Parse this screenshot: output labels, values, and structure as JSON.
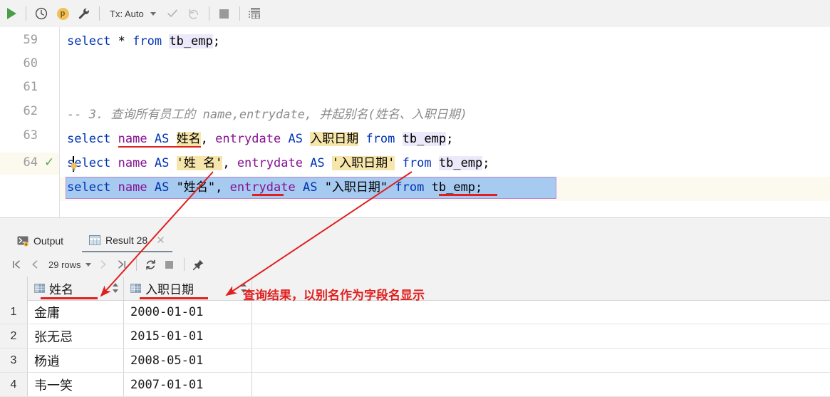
{
  "toolbar": {
    "run_icon": "run-triangle-icon",
    "history_icon": "clock-history-icon",
    "profile_icon": "profile-p-icon",
    "profile_letter": "p",
    "settings_icon": "wrench-icon",
    "tx_label": "Tx: Auto",
    "tx_chevron_icon": "chevron-down-icon",
    "commit_icon": "commit-check-icon",
    "rollback_icon": "rollback-icon",
    "stop_icon": "stop-square-icon",
    "data_editor_icon": "table-grid-icon"
  },
  "editor": {
    "lines": [
      {
        "num": "59",
        "marker": ""
      },
      {
        "num": "60",
        "marker": ""
      },
      {
        "num": "61",
        "marker": ""
      },
      {
        "num": "62",
        "marker": ""
      },
      {
        "num": "63",
        "marker": ""
      },
      {
        "num": "64",
        "marker": "check-icon"
      }
    ],
    "line59": {
      "kw1": "select",
      "star": " * ",
      "kw2": "from",
      "space": " ",
      "table": "tb_emp",
      "semi": ";"
    },
    "line61_comment": "-- 3. 查询所有员工的 name,entrydate, 并起别名(姓名、入职日期)",
    "line62": {
      "kw_select": "select",
      "col1": "name",
      "kw_as1": "AS",
      "alias1": "姓名",
      "comma": ", ",
      "col2": "entrydate",
      "kw_as2": "AS",
      "alias2": "入职日期",
      "kw_from": "from",
      "table": "tb_emp",
      "semi": ";"
    },
    "line63": {
      "kw_select": "select",
      "col1": "name",
      "kw_as1": "AS",
      "alias1": "'姓 名'",
      "comma": ", ",
      "col2": "entrydate",
      "kw_as2": "AS",
      "alias2": "'入职日期'",
      "kw_from": "from",
      "table": "tb_emp",
      "semi": ";"
    },
    "line64": {
      "kw_select": "select",
      "col1": "name",
      "kw_as1": "AS",
      "alias1": "\"姓名\"",
      "comma": ", ",
      "col2": "entrydate",
      "kw_as2": "AS",
      "alias2": "\"入职日期\"",
      "kw_from": "from",
      "table": "tb_emp",
      "semi": ";"
    }
  },
  "panel": {
    "tabs": [
      {
        "label": "Output",
        "icon": "console-output-icon",
        "selected": false
      },
      {
        "label": "Result 28",
        "icon": "result-grid-icon",
        "selected": true,
        "close_icon": "close-icon"
      }
    ],
    "gridbar": {
      "first_page_icon": "first-page-icon",
      "prev_page_icon": "prev-page-icon",
      "rows_label": "29 rows",
      "rows_chevron_icon": "chevron-down-icon",
      "next_page_icon": "next-page-icon",
      "last_page_icon": "last-page-icon",
      "refresh_icon": "refresh-icon",
      "stop_icon": "stop-square-icon",
      "pin_icon": "pin-icon"
    }
  },
  "result_table": {
    "columns": [
      {
        "label": "姓名",
        "icon": "column-icon",
        "sorter_icon": "sort-updown-icon"
      },
      {
        "label": "入职日期",
        "icon": "column-icon",
        "sorter_icon": "sort-updown-icon"
      }
    ],
    "rows": [
      {
        "n": "1",
        "cells": [
          "金庸",
          "2000-01-01"
        ]
      },
      {
        "n": "2",
        "cells": [
          "张无忌",
          "2015-01-01"
        ]
      },
      {
        "n": "3",
        "cells": [
          "杨逍",
          "2008-05-01"
        ]
      },
      {
        "n": "4",
        "cells": [
          "韦一笑",
          "2007-01-01"
        ]
      }
    ]
  },
  "annotations": {
    "note": "查询结果，以别名作为字段名显示",
    "color": "#e02020",
    "arrow1_name": "arrow-alias-name",
    "arrow2_name": "arrow-alias-entrydate"
  },
  "colors": {
    "keyword": "#0033b3",
    "identifier": "#871094",
    "comment": "#8c8c8c",
    "alias_highlight": "#f7e6ab",
    "table_highlight": "#ece9fb",
    "selection": "#a6caf0",
    "current_line": "#fcfaef",
    "annotation_red": "#e02020",
    "run_green": "#4a9e4a"
  }
}
